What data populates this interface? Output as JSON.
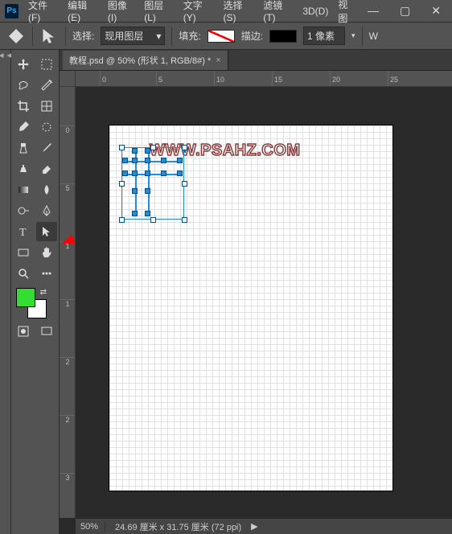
{
  "app": {
    "logo_text": "Ps"
  },
  "menu": [
    "文件(F)",
    "编辑(E)",
    "图像(I)",
    "图层(L)",
    "文字(Y)",
    "选择(S)",
    "滤镜(T)",
    "3D(D)",
    "视图"
  ],
  "window_controls": {
    "min": "—",
    "max": "▢",
    "close": "✕"
  },
  "options": {
    "select_label": "选择:",
    "select_value": "现用图层",
    "fill_label": "填充:",
    "stroke_label": "描边:",
    "stroke_width": "1 像素",
    "w_label": "W"
  },
  "document": {
    "tab_title": "教程.psd @ 50% (形状 1, RGB/8#) *",
    "watermark": "WWW.PSAHZ.COM"
  },
  "rulers": {
    "h": [
      {
        "pos": 30,
        "label": "0"
      },
      {
        "pos": 100,
        "label": "5"
      },
      {
        "pos": 172,
        "label": "10"
      },
      {
        "pos": 244,
        "label": "15"
      },
      {
        "pos": 316,
        "label": "20"
      },
      {
        "pos": 388,
        "label": "25"
      }
    ],
    "v": [
      {
        "pos": 48,
        "label": "0"
      },
      {
        "pos": 120,
        "label": "5"
      },
      {
        "pos": 192,
        "label": "1"
      },
      {
        "pos": 264,
        "label": "1"
      },
      {
        "pos": 336,
        "label": "2"
      },
      {
        "pos": 408,
        "label": "2"
      },
      {
        "pos": 480,
        "label": "3"
      }
    ]
  },
  "colors": {
    "fg": "#33dd33"
  },
  "status": {
    "zoom": "50%",
    "docsize": "24.69 厘米 x 31.75 厘米 (72 ppi)",
    "arrow": "▶"
  }
}
